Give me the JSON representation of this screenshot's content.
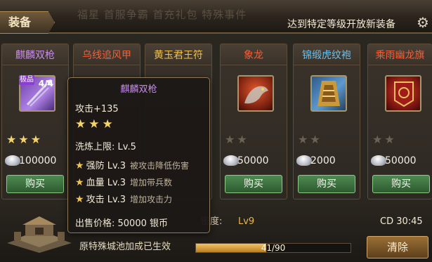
{
  "header": {
    "title": "装备",
    "background_text": "福星 首服争霸 首充礼包 特殊事件",
    "notice": "达到特定等级开放新装备"
  },
  "colors": {
    "purple_name": "#c98bf0",
    "red_name": "#f2603c",
    "gold_name": "#f2c14b",
    "blue_name": "#6cc2ee"
  },
  "cards": [
    {
      "name": "麒麟双枪",
      "name_color": "#c98bf0",
      "icon": "twin-spear-icon",
      "badge": "极品",
      "count": "4/4",
      "stars": "★★★",
      "price": "100000",
      "buy_label": "购买"
    },
    {
      "name": "乌线追风甲",
      "name_color": "#f2603c",
      "icon": "armor-icon",
      "stars": "",
      "price": "",
      "buy_label": ""
    },
    {
      "name": "黄玉君王符",
      "name_color": "#f2c14b",
      "icon": "talisman-icon",
      "stars": "",
      "price": "",
      "buy_label": ""
    },
    {
      "name": "象龙",
      "name_color": "#f2603c",
      "icon": "dragon-mount-icon",
      "stars_on": "",
      "stars_off": "★★",
      "price": "50000",
      "buy_label": "购买"
    },
    {
      "name": "锦缎虎纹袍",
      "name_color": "#6cc2ee",
      "icon": "tiger-robe-icon",
      "stars_on": "",
      "stars_off": "★★",
      "price": "2000",
      "buy_label": "购买"
    },
    {
      "name": "乘雨幽龙旗",
      "name_color": "#f2603c",
      "icon": "dragon-banner-icon",
      "stars_on": "",
      "stars_off": "★★",
      "price": "50000",
      "buy_label": "购买"
    }
  ],
  "tooltip": {
    "title": "麒麟双枪",
    "attack": "攻击+135",
    "stars": "★★★",
    "refine_limit": "洗炼上限: Lv.5",
    "skills": [
      {
        "name": "强防 Lv.3",
        "desc": "被攻击降低伤害"
      },
      {
        "name": "血量 Lv.3",
        "desc": "增加带兵数"
      },
      {
        "name": "攻击 Lv.3",
        "desc": "增加攻击力"
      }
    ],
    "sell_price": "出售价格: 50000 银币"
  },
  "bottom": {
    "buff_text": "原特殊城池加成已生效",
    "density_label": "密度:",
    "density_value": "Lv9",
    "cd": "CD 30:45",
    "progress_text": "41/90",
    "progress_fraction": 0.4556,
    "clear_label": "清除"
  }
}
